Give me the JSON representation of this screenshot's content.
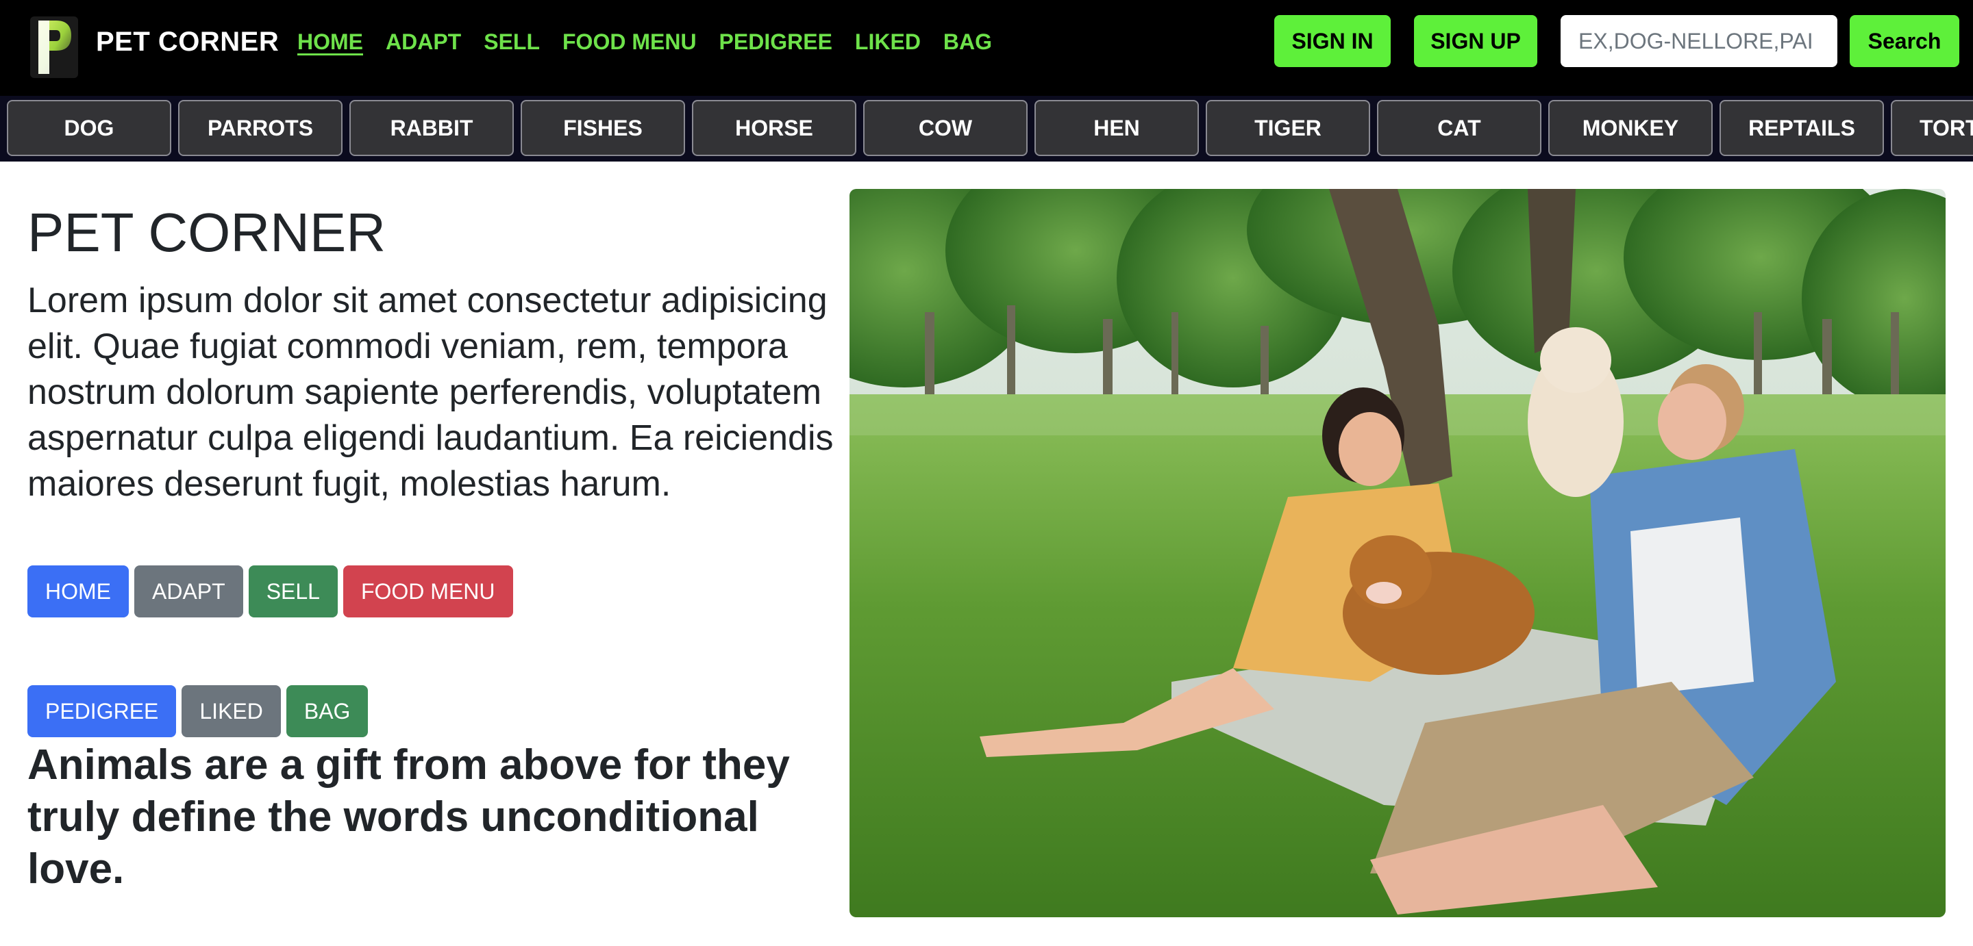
{
  "header": {
    "brand": "PET CORNER",
    "nav": [
      {
        "label": "HOME"
      },
      {
        "label": "ADAPT"
      },
      {
        "label": "SELL"
      },
      {
        "label": "FOOD MENU"
      },
      {
        "label": "PEDIGREE"
      },
      {
        "label": "LIKED"
      },
      {
        "label": "BAG"
      }
    ],
    "signin_label": "SIGN IN",
    "signup_label": "SIGN UP",
    "search_placeholder": "EX,DOG-NELLORE,PAI",
    "search_label": "Search",
    "accent_color": "#5ef03a",
    "logo_letter": "P"
  },
  "categories": [
    {
      "label": "DOG"
    },
    {
      "label": "PARROTS"
    },
    {
      "label": "RABBIT"
    },
    {
      "label": "FISHES"
    },
    {
      "label": "HORSE"
    },
    {
      "label": "COW"
    },
    {
      "label": "HEN"
    },
    {
      "label": "TIGER"
    },
    {
      "label": "CAT"
    },
    {
      "label": "MONKEY"
    },
    {
      "label": "REPTAILS"
    },
    {
      "label": "TORT"
    }
  ],
  "main": {
    "title": "PET CORNER",
    "lead": "Lorem ipsum dolor sit amet consectetur adipisicing elit. Quae fugiat commodi veniam, rem, tempora nostrum dolorum sapiente perferendis, voluptatem aspernatur culpa eligendi laudantium. Ea reiciendis maiores deserunt fugit, molestias harum.",
    "buttons_row1": [
      {
        "label": "HOME",
        "color": "#3b6ff5"
      },
      {
        "label": "ADAPT",
        "color": "#6c757d"
      },
      {
        "label": "SELL",
        "color": "#3d8b57"
      },
      {
        "label": "FOOD MENU",
        "color": "#d2434f"
      }
    ],
    "buttons_row2": [
      {
        "label": "PEDIGREE",
        "color": "#3b6ff5"
      },
      {
        "label": "LIKED",
        "color": "#6c757d"
      },
      {
        "label": "BAG",
        "color": "#3d8b57"
      }
    ],
    "quote": "Animals are a gift from above for they truly define the words unconditional love."
  }
}
